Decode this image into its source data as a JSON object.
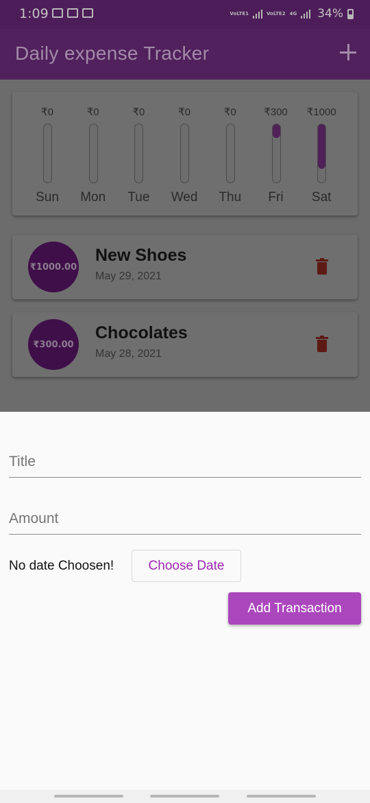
{
  "status_bar": {
    "time": "1:09",
    "sim1": "VoLTE1",
    "sim2": "VoLTE2",
    "network": "4G",
    "battery": "34%"
  },
  "app_bar": {
    "title": "Daily expense Tracker"
  },
  "chart": {
    "bars": [
      {
        "day": "Sun",
        "amount": "₹0",
        "fill": 0
      },
      {
        "day": "Mon",
        "amount": "₹0",
        "fill": 0
      },
      {
        "day": "Tue",
        "amount": "₹0",
        "fill": 0
      },
      {
        "day": "Wed",
        "amount": "₹0",
        "fill": 0
      },
      {
        "day": "Thu",
        "amount": "₹0",
        "fill": 0
      },
      {
        "day": "Fri",
        "amount": "₹300",
        "fill": 0.23
      },
      {
        "day": "Sat",
        "amount": "₹1000",
        "fill": 0.77
      }
    ]
  },
  "transactions": [
    {
      "amount": "₹1000.00",
      "title": "New Shoes",
      "date": "May 29, 2021"
    },
    {
      "amount": "₹300.00",
      "title": "Chocolates",
      "date": "May 28, 2021"
    }
  ],
  "form": {
    "title_placeholder": "Title",
    "amount_placeholder": "Amount",
    "date_status": "No date Choosen!",
    "choose_date_label": "Choose Date",
    "submit_label": "Add Transaction"
  },
  "colors": {
    "primary": "#9c27b0",
    "button": "#ab47bc",
    "delete": "#c62828"
  }
}
